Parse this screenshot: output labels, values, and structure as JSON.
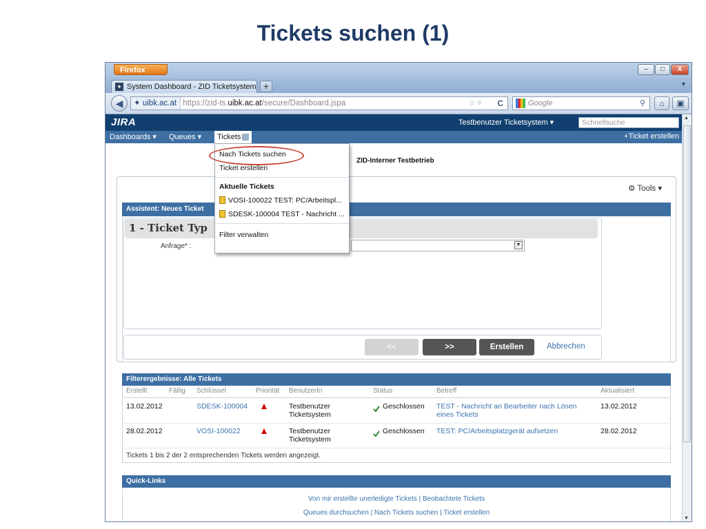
{
  "slide": {
    "title": "Tickets suchen (1)"
  },
  "browser": {
    "app_button": "Firefox",
    "window_controls": [
      "–",
      "□",
      "X"
    ],
    "tab_title": "System Dashboard - ZID Ticketsystem",
    "new_tab": "+",
    "identity": "uibk.ac.at",
    "url_prefix": "https://zid-ts.",
    "url_host": "uibk.ac.at",
    "url_path": "/secure/Dashboard.jspa",
    "search_placeholder": "Google"
  },
  "jira": {
    "logo": "JIRA",
    "user_menu": "Testbenutzer Ticketsystem",
    "quicksearch_placeholder": "Schnellsuche",
    "nav": {
      "dashboards": "Dashboards",
      "queues": "Queues",
      "tickets": "Tickets",
      "create": "Ticket erstellen"
    },
    "page_subtitle": "ZID-Interner Testbetrieb",
    "tools": "Tools",
    "tickets_menu": {
      "search": "Nach Tickets suchen",
      "create": "Ticket erstellen",
      "recent_header": "Aktuelle Tickets",
      "recent": [
        "VOSI-100022 TEST: PC/Arbeitspl...",
        "SDESK-100004 TEST - Nachricht ..."
      ],
      "manage_filters": "Filter verwalten"
    },
    "wizard": {
      "header": "Assistent: Neues Ticket",
      "step_title": "1 - Ticket Typ",
      "request_label": "Anfrage* :",
      "btn_prev": "<<",
      "btn_next": ">>",
      "btn_create": "Erstellen",
      "btn_cancel": "Abbrechen"
    },
    "filter": {
      "header": "Filterergebnisse: Alle Tickets",
      "columns": [
        "Erstellt",
        "Fällig",
        "Schlüssel",
        "Priorität",
        "BenutzerIn",
        "Status",
        "Betreff",
        "Aktualisiert"
      ],
      "rows": [
        {
          "created": "13.02.2012",
          "key": "SDESK-100004",
          "user": "Testbenutzer\nTicketsystem",
          "status": "Geschlossen",
          "subject": "TEST - Nachricht an Bearbeiter nach Lösen\neines Tickets",
          "updated": "13.02.2012"
        },
        {
          "created": "28.02.2012",
          "key": "VOSI-100022",
          "user": "Testbenutzer\nTicketsystem",
          "status": "Geschlossen",
          "subject": "TEST: PC/Arbeitsplatzgerät aufsetzen",
          "updated": "28.02.2012"
        }
      ],
      "count_text": "Tickets 1 bis 2 der 2 entsprechenden Tickets werden angezeigt."
    },
    "quicklinks": {
      "header": "Quick-Links",
      "line1": "Von mir erstellte unerledigte Tickets | Beobachtete Tickets",
      "line2": "Queues durchsuchen | Nach Tickets suchen | Ticket erstellen"
    }
  },
  "colors": {
    "jira_header": "#114070",
    "jira_nav": "#3d6fa3",
    "link": "#3b73af",
    "highlight": "#c8473a",
    "slide_title": "#1f3a66"
  },
  "icons": [
    "back-arrow-icon",
    "star-icon",
    "reload-icon",
    "search-icon",
    "home-icon",
    "gear-icon",
    "priority-up-icon",
    "status-closed-icon",
    "ticket-icon"
  ]
}
